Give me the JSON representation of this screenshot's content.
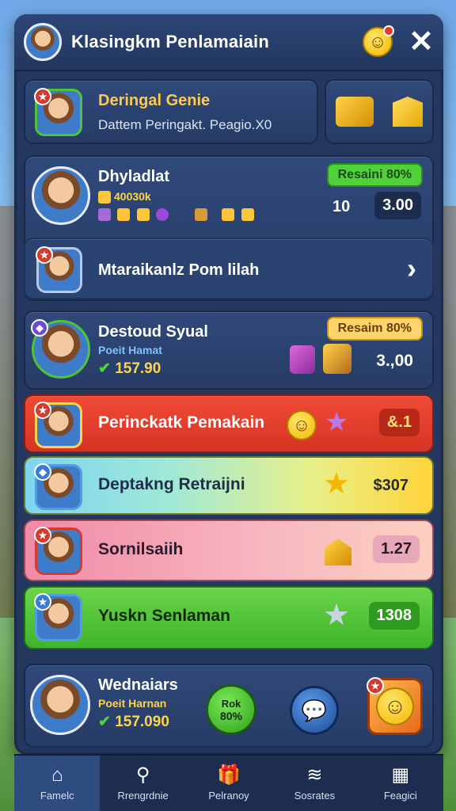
{
  "header": {
    "title": "Klasingkm Penlamaiain",
    "close_label": "✕",
    "smiley_icon": "smiley-icon"
  },
  "featured": {
    "title": "Deringal Genie",
    "subtitle": "Dattem Peringakt. Peagio.X0"
  },
  "player1": {
    "name": "Dhyladlat",
    "gold_line": "40030k",
    "badge": "Resaini 80%",
    "count": "10",
    "value": "3.00"
  },
  "promo_row": {
    "label": "Mtaraikanlz Pom lilah",
    "chevron": "›"
  },
  "player2": {
    "name": "Destoud Syual",
    "sub": "Poeit Hamat",
    "score": "157.90",
    "badge": "Resaim 80%",
    "value": "3.,00"
  },
  "rows": [
    {
      "label": "Perinckatk Pemakain",
      "value": "&.1",
      "bg": "#e2412f"
    },
    {
      "label": "Deptakng Retraijni",
      "value": "$307",
      "bg": "rainbow"
    },
    {
      "label": "Sornilsaiih",
      "value": "1.27",
      "bg": "#f4a3b8"
    },
    {
      "label": "Yuskn Senlaman",
      "value": "1308",
      "bg": "#4fc43a"
    }
  ],
  "bottom_card": {
    "name": "Wednaiars",
    "sub": "Poeit Harnan",
    "score": "157.090",
    "button_top": "Rok",
    "button_bottom": "80%"
  },
  "nav": [
    {
      "label": "Famelc",
      "icon": "home-icon",
      "glyph": "⌂"
    },
    {
      "label": "Rrengrdnie",
      "icon": "search-icon",
      "glyph": "⚲"
    },
    {
      "label": "Pelranoy",
      "icon": "gift-icon",
      "glyph": "🎁"
    },
    {
      "label": "Sosrates",
      "icon": "stack-icon",
      "glyph": "≋"
    },
    {
      "label": "Feagici",
      "icon": "chart-icon",
      "glyph": "▦"
    }
  ]
}
